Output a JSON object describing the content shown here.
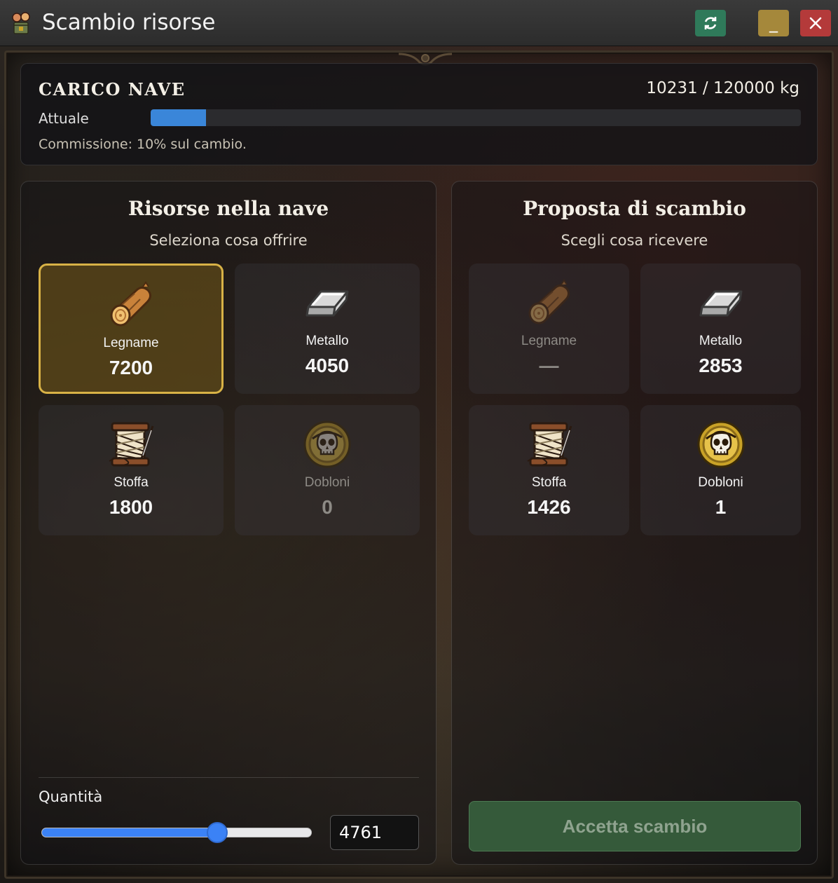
{
  "window": {
    "title": "Scambio risorse",
    "refresh_icon": "refresh-icon",
    "minimize_label": "_",
    "close_icon": "close-icon",
    "colors": {
      "refresh": "#2f7a5a",
      "minimize": "#a5883b",
      "close": "#b43a3a"
    }
  },
  "cargo": {
    "title": "CARICO NAVE",
    "amount": "10231 / 120000 kg",
    "current_label": "Attuale",
    "fill_fraction": 0.0853,
    "commission": "Commissione: 10% sul cambio."
  },
  "offer": {
    "title": "Risorse nella nave",
    "subtitle": "Seleziona cosa offrire",
    "items": [
      {
        "icon": "log-icon",
        "name": "Legname",
        "value": "7200",
        "selected": true,
        "disabled": false
      },
      {
        "icon": "metal-ingot-icon",
        "name": "Metallo",
        "value": "4050",
        "selected": false,
        "disabled": false
      },
      {
        "icon": "thread-spool-icon",
        "name": "Stoffa",
        "value": "1800",
        "selected": false,
        "disabled": false
      },
      {
        "icon": "skull-coin-icon",
        "name": "Dobloni",
        "value": "0",
        "selected": false,
        "disabled": true
      }
    ],
    "quantity_label": "Quantità",
    "quantity_value": "4761",
    "slider_fraction": 0.65
  },
  "receive": {
    "title": "Proposta di scambio",
    "subtitle": "Scegli cosa ricevere",
    "items": [
      {
        "icon": "log-icon",
        "name": "Legname",
        "value": "—",
        "disabled": true
      },
      {
        "icon": "metal-ingot-icon",
        "name": "Metallo",
        "value": "2853",
        "disabled": false
      },
      {
        "icon": "thread-spool-icon",
        "name": "Stoffa",
        "value": "1426",
        "disabled": false
      },
      {
        "icon": "skull-coin-icon",
        "name": "Dobloni",
        "value": "1",
        "disabled": false
      }
    ],
    "accept_label": "Accetta scambio"
  }
}
